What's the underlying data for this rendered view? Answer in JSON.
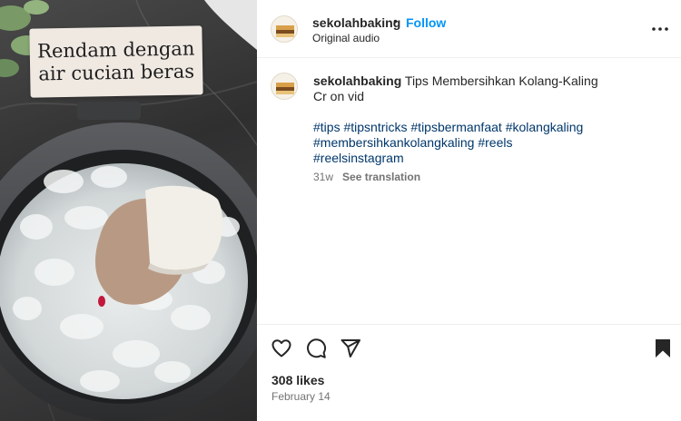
{
  "media": {
    "overlay_text": "Rendam dengan\nair cucian beras"
  },
  "post": {
    "username": "sekolahbaking",
    "separator": "•",
    "follow_label": "Follow",
    "audio": "Original audio"
  },
  "caption": {
    "username": "sekolahbaking",
    "title": "Tips Membersihkan Kolang-Kaling",
    "credit": "Cr on vid",
    "hashtags": [
      "#tips",
      "#tipsntricks",
      "#tipsbermanfaat",
      "#kolangkaling",
      "#membersihkankolangkaling",
      "#reels",
      "#reelsinstagram"
    ],
    "age": "31w",
    "translate_label": "See translation"
  },
  "actions": {
    "icons": [
      "heart-icon",
      "comment-icon",
      "share-icon",
      "bookmark-icon"
    ]
  },
  "stats": {
    "likes": "308 likes",
    "date": "February 14"
  },
  "colors": {
    "follow": "#0095f6",
    "hashtag": "#00376b",
    "muted": "#737373"
  }
}
